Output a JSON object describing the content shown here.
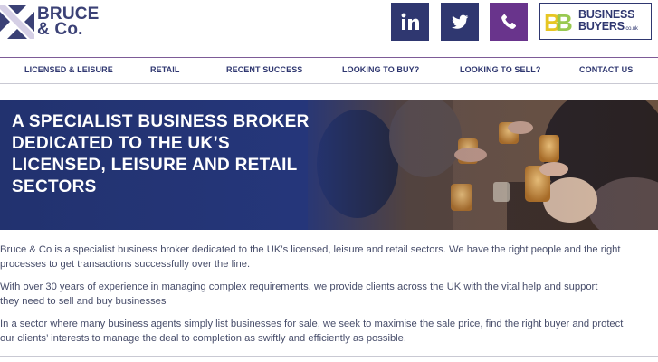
{
  "brand": {
    "line1": "BRUCE",
    "line2": "& Co."
  },
  "social": [
    {
      "name": "linkedin-icon",
      "label": "in"
    },
    {
      "name": "twitter-icon"
    },
    {
      "name": "phone-icon"
    }
  ],
  "partner_logo": {
    "line1": "BUSINESS",
    "line2": "BUYERS",
    "tld": ".co.uk",
    "mark": "BB"
  },
  "nav": [
    "LICENSED & LEISURE",
    "RETAIL",
    "RECENT SUCCESS",
    "LOOKING TO BUY?",
    "LOOKING TO SELL?",
    "CONTACT US"
  ],
  "hero": {
    "title_lines": [
      "A SPECIALIST BUSINESS BROKER",
      "DEDICATED TO THE UK’S",
      "LICENSED, LEISURE AND RETAIL",
      "SECTORS"
    ]
  },
  "intro": [
    [
      "Bruce & Co is a specialist business broker dedicated to the UK’s licensed, leisure and retail sectors. We have the right people and the right",
      "processes to get transactions successfully over the line."
    ],
    [
      "With over 30 years of experience in managing complex requirements, we provide clients across the UK with the vital help and support",
      "they need to sell and buy businesses"
    ],
    [
      "In a sector where many business agents simply list businesses for sale, we seek to maximise the sale price, find the right buyer and protect",
      "our clients’ interests to manage the deal to completion as swiftly and efficiently as possible."
    ]
  ],
  "colors": {
    "brand_navy": "#2f3770",
    "brand_purple": "#69348c",
    "hero_blue": "#24357a"
  }
}
